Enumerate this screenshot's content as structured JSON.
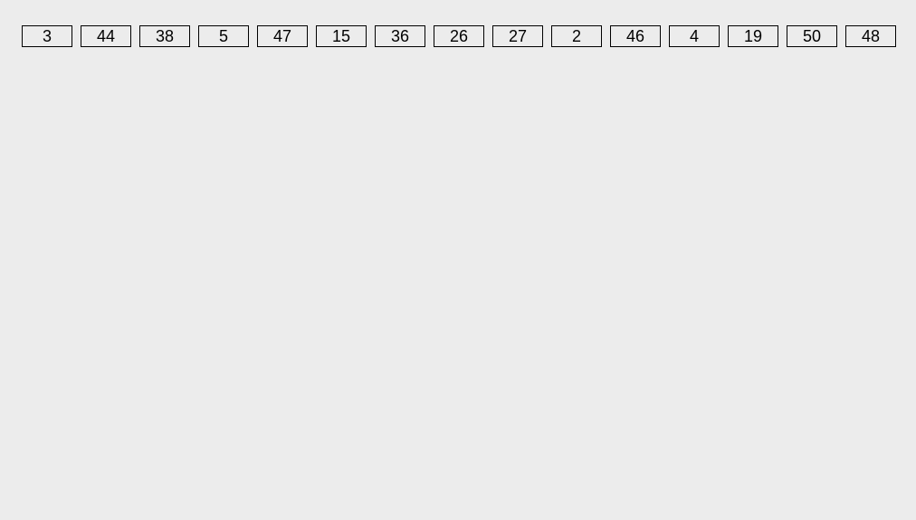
{
  "numbers": [
    3,
    44,
    38,
    5,
    47,
    15,
    36,
    26,
    27,
    2,
    46,
    4,
    19,
    50,
    48
  ]
}
